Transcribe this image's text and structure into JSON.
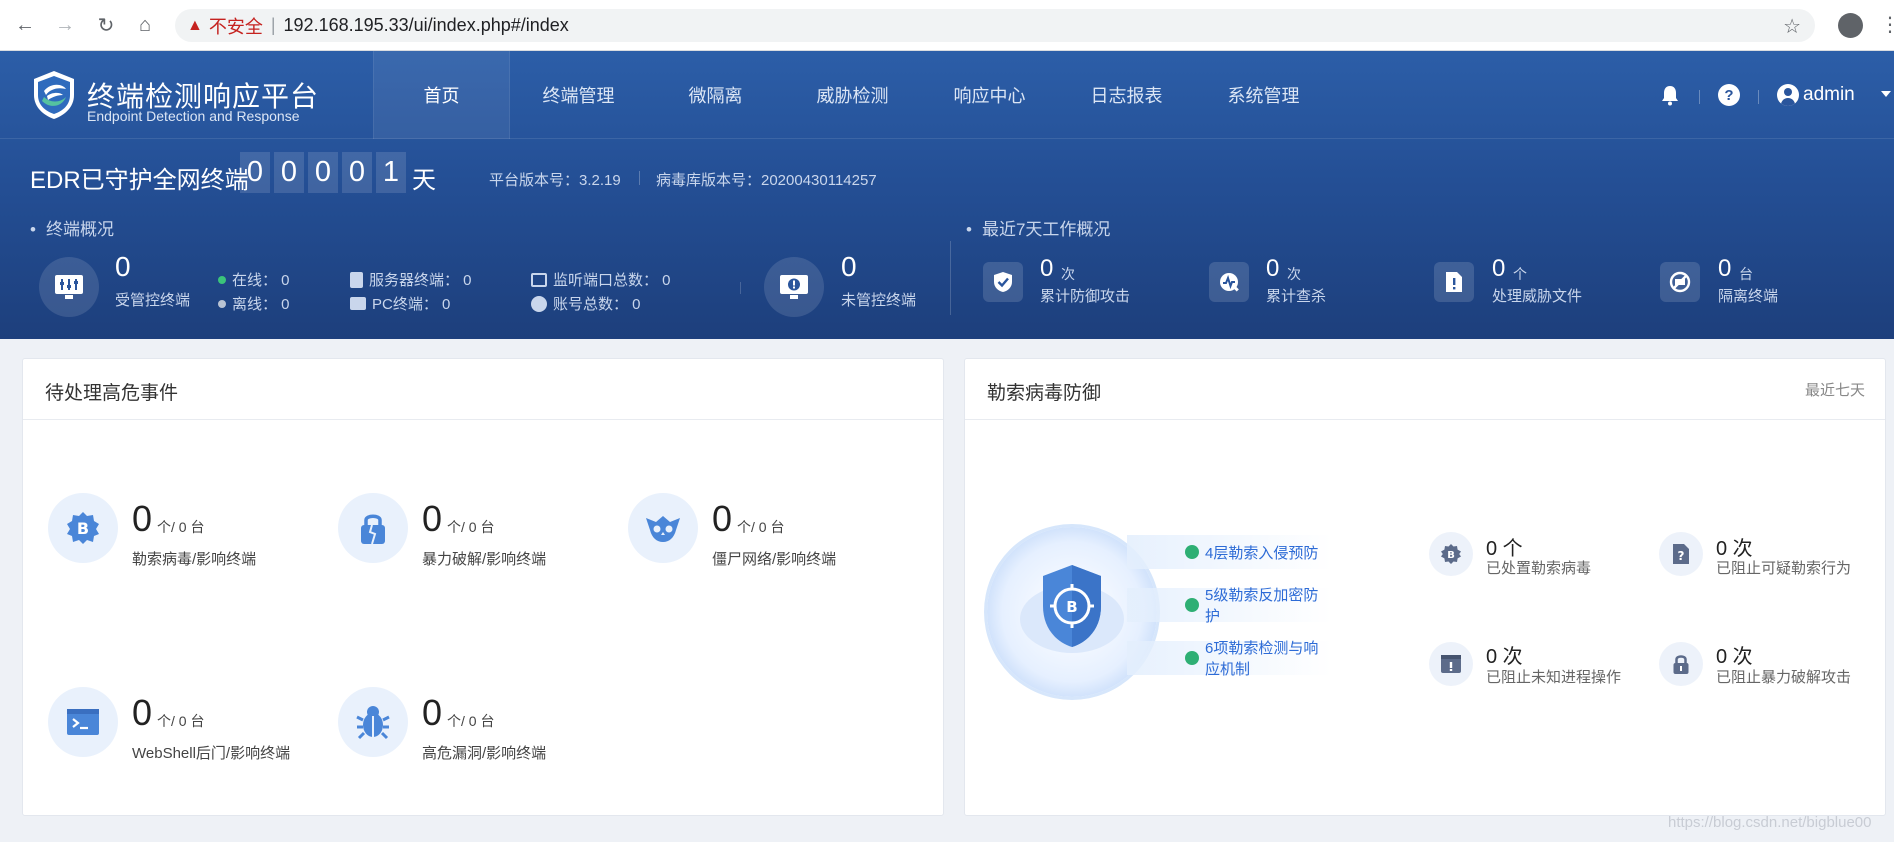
{
  "browser": {
    "insecure_label": "不安全",
    "url": "192.168.195.33/ui/index.php#/index"
  },
  "brand": {
    "name_cn": "终端检测响应平台",
    "name_en": "Endpoint Detection and Response"
  },
  "nav": {
    "items": [
      "首页",
      "终端管理",
      "微隔离",
      "威胁检测",
      "响应中心",
      "日志报表",
      "系统管理"
    ],
    "active": "首页"
  },
  "user": {
    "name": "admin"
  },
  "guard": {
    "title": "EDR已守护全网终端",
    "days_digits": [
      "0",
      "0",
      "0",
      "0",
      "1"
    ],
    "unit": "天",
    "platform_version": "平台版本号：3.2.19",
    "virus_db_version": "病毒库版本号：20200430114257"
  },
  "overview": {
    "section_title": "终端概况",
    "managed": {
      "value": "0",
      "label": "受管控终端"
    },
    "online": "在线：  0",
    "offline": "离线：  0",
    "server_endpoints": "服务器终端：  0",
    "pc_endpoints": "PC终端：  0",
    "listen_ports": "监听端口总数：  0",
    "accounts": "账号总数：  0",
    "unmanaged": {
      "value": "0",
      "label": "未管控终端"
    },
    "colors": {
      "online": "#3bc47a",
      "offline": "#b9c3d3"
    }
  },
  "weekly": {
    "section_title": "最近7天工作概况",
    "items": [
      {
        "value": "0",
        "unit": "次",
        "label": "累计防御攻击",
        "icon": "shield-check-icon"
      },
      {
        "value": "0",
        "unit": "次",
        "label": "累计查杀",
        "icon": "scan-kill-icon"
      },
      {
        "value": "0",
        "unit": "个",
        "label": "处理威胁文件",
        "icon": "threat-file-icon"
      },
      {
        "value": "0",
        "unit": "台",
        "label": "隔离终端",
        "icon": "isolate-icon"
      }
    ]
  },
  "high_risk": {
    "title": "待处理高危事件",
    "events": [
      {
        "value": "0",
        "unit": "个/ 0 台",
        "label": "勒索病毒/影响终端",
        "icon": "bitcoin-virus-icon"
      },
      {
        "value": "0",
        "unit": "个/ 0 台",
        "label": "暴力破解/影响终端",
        "icon": "lock-crack-icon"
      },
      {
        "value": "0",
        "unit": "个/ 0 台",
        "label": "僵尸网络/影响终端",
        "icon": "botnet-skull-icon"
      },
      {
        "value": "0",
        "unit": "个/ 0 台",
        "label": "WebShell后门/影响终端",
        "icon": "terminal-icon"
      },
      {
        "value": "0",
        "unit": "个/ 0 台",
        "label": "高危漏洞/影响终端",
        "icon": "bug-icon"
      }
    ]
  },
  "ransomware": {
    "title": "勒索病毒防御",
    "range": "最近七天",
    "layers": [
      "4层勒索入侵预防",
      "5级勒索反加密防护",
      "6项勒索检测与响应机制"
    ],
    "stats": [
      {
        "value": "0 个",
        "label": "已处置勒索病毒",
        "icon": "bitcoin-icon"
      },
      {
        "value": "0 次",
        "label": "已阻止可疑勒索行为",
        "icon": "question-icon"
      },
      {
        "value": "0 次",
        "label": "已阻止未知进程操作",
        "icon": "process-block-icon"
      },
      {
        "value": "0 次",
        "label": "已阻止暴力破解攻击",
        "icon": "lock-icon"
      }
    ]
  },
  "watermark": "https://blog.csdn.net/bigblue00",
  "theme": {
    "accent": "#2a559c",
    "link": "#2d6bd6",
    "icon_blue": "#4a86d8"
  }
}
